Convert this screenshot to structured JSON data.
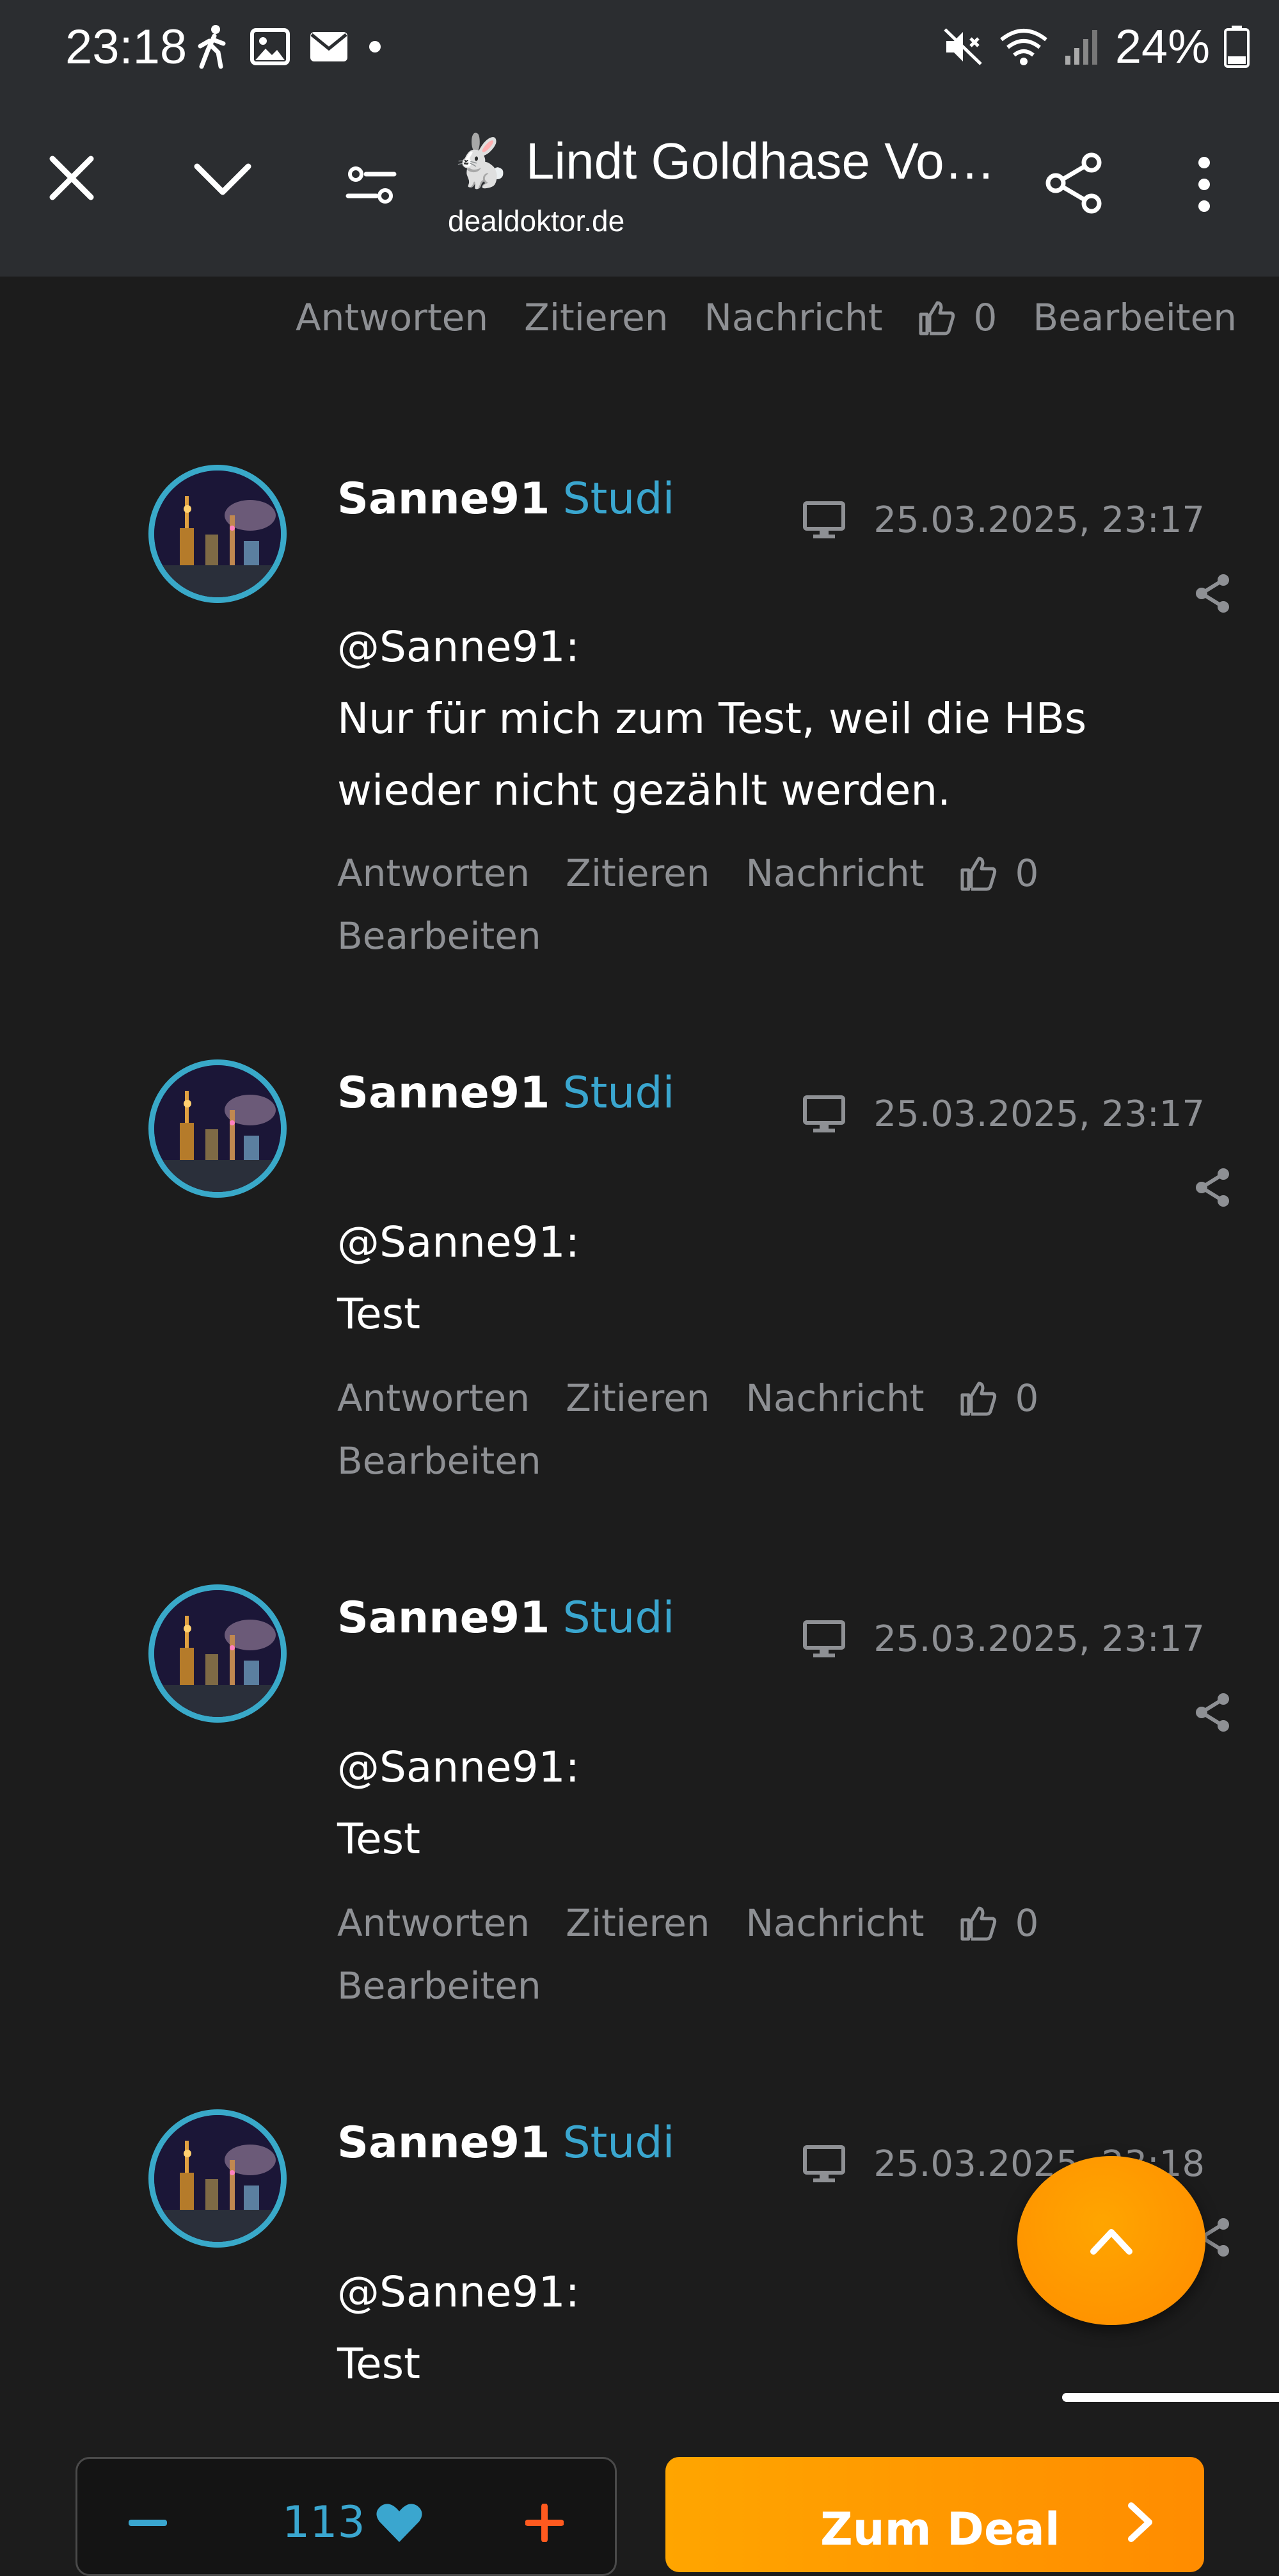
{
  "status_bar": {
    "time": "23:18",
    "battery": "24%"
  },
  "app_bar": {
    "title": "🐇 Lindt Goldhase Vol...",
    "subtitle": "dealdoktor.de"
  },
  "top_actions": {
    "reply": "Antworten",
    "quote": "Zitieren",
    "message": "Nachricht",
    "likes": "0",
    "edit": "Bearbeiten"
  },
  "comments": [
    {
      "user": "Sanne91",
      "role": "Studi",
      "timestamp": "25.03.2025, 23:17",
      "mention": "@Sanne91:",
      "text": "Nur für mich zum Test, weil die HBs wieder nicht gezählt werden.",
      "actions": {
        "reply": "Antworten",
        "quote": "Zitieren",
        "message": "Nachricht",
        "likes": "0",
        "edit": "Bearbeiten"
      }
    },
    {
      "user": "Sanne91",
      "role": "Studi",
      "timestamp": "25.03.2025, 23:17",
      "mention": "@Sanne91:",
      "text": "Test",
      "actions": {
        "reply": "Antworten",
        "quote": "Zitieren",
        "message": "Nachricht",
        "likes": "0",
        "edit": "Bearbeiten"
      }
    },
    {
      "user": "Sanne91",
      "role": "Studi",
      "timestamp": "25.03.2025, 23:17",
      "mention": "@Sanne91:",
      "text": "Test",
      "actions": {
        "reply": "Antworten",
        "quote": "Zitieren",
        "message": "Nachricht",
        "likes": "0",
        "edit": "Bearbeiten"
      }
    },
    {
      "user": "Sanne91",
      "role": "Studi",
      "timestamp": "25.03.2025, 23:18",
      "mention": "@Sanne91:",
      "text": "Test"
    }
  ],
  "bottom_bar": {
    "vote_count": "113",
    "deal_label": "Zum Deal"
  },
  "colors": {
    "background": "#1c1c1c",
    "appbar": "#2b2d30",
    "accent_blue": "#3aa6cf",
    "accent_orange": "#ff9800",
    "muted": "#8e9094"
  }
}
